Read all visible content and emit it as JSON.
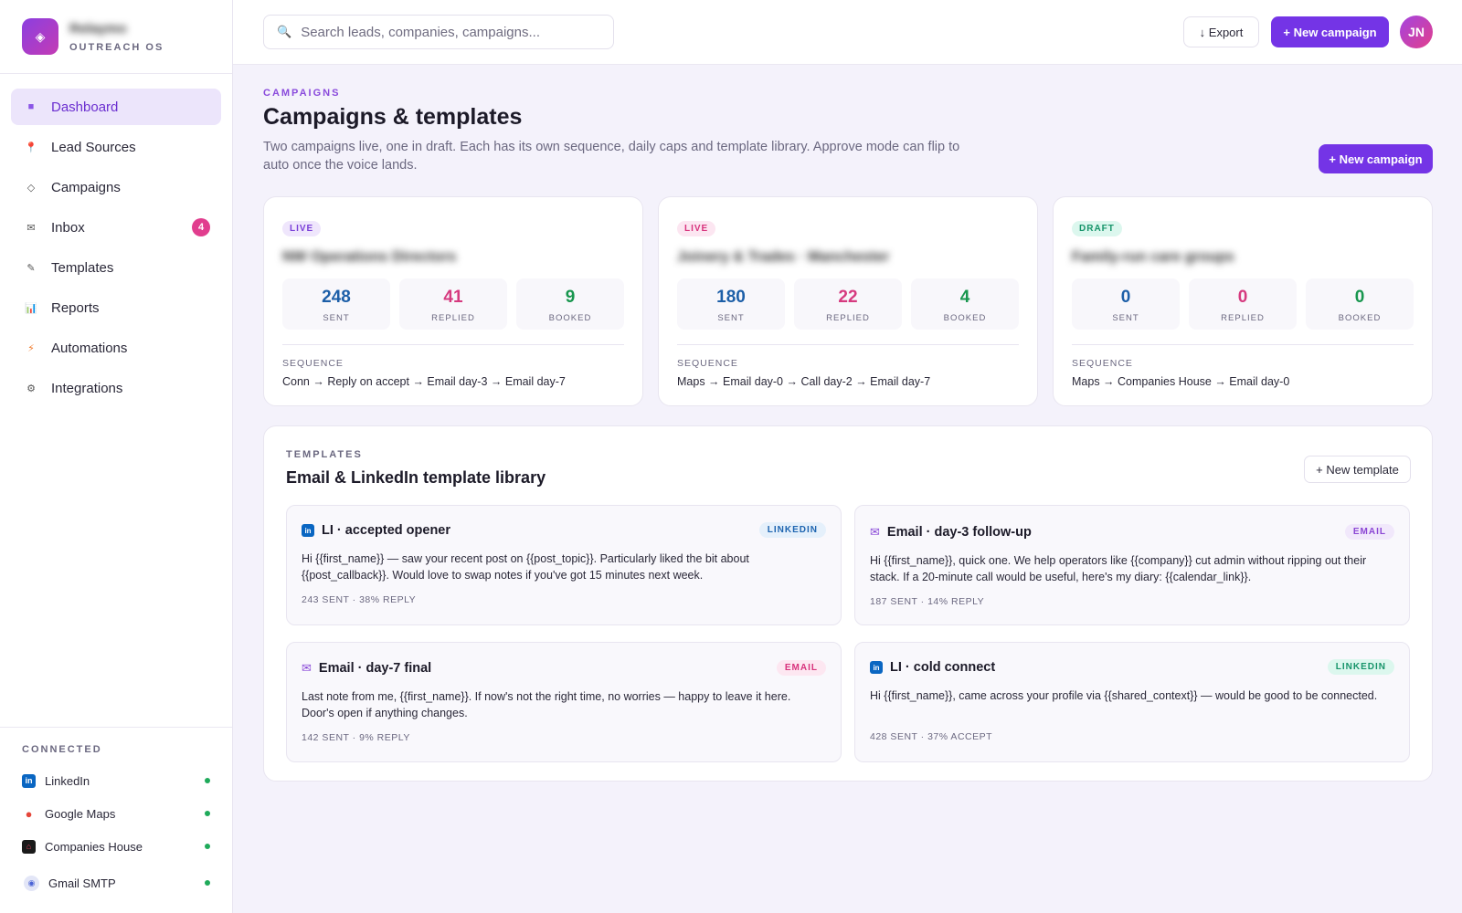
{
  "brand": {
    "name": "Relaymo",
    "subtitle": "OUTREACH OS",
    "logo_icon": "diamond-icon"
  },
  "sidebar": {
    "items": [
      {
        "label": "Dashboard",
        "icon": "grid-square-icon",
        "active": true
      },
      {
        "label": "Lead Sources",
        "icon": "pin-icon"
      },
      {
        "label": "Campaigns",
        "icon": "diamond-outline-icon"
      },
      {
        "label": "Inbox",
        "icon": "mail-icon",
        "badge": "4"
      },
      {
        "label": "Templates",
        "icon": "pen-icon"
      },
      {
        "label": "Reports",
        "icon": "bar-chart-icon"
      },
      {
        "label": "Automations",
        "icon": "bolt-icon"
      },
      {
        "label": "Integrations",
        "icon": "gear-icon"
      }
    ],
    "connected_title": "CONNECTED",
    "connected": [
      {
        "label": "LinkedIn",
        "icon": "linkedin-icon",
        "status": "connected"
      },
      {
        "label": "Google Maps",
        "icon": "map-pin-icon",
        "status": "connected"
      },
      {
        "label": "Companies House",
        "icon": "companies-house-icon",
        "status": "connected"
      },
      {
        "label": "Gmail SMTP",
        "icon": "gmail-icon",
        "status": "connected"
      }
    ]
  },
  "topbar": {
    "search_placeholder": "Search leads, companies, campaigns...",
    "export_label": "↓ Export",
    "new_campaign_label": "+ New campaign",
    "avatar_initials": "JN"
  },
  "page": {
    "eyebrow": "CAMPAIGNS",
    "title": "Campaigns & templates",
    "description": "Two campaigns live, one in draft. Each has its own sequence, daily caps and template library. Approve mode can flip to auto once the voice lands.",
    "new_campaign_label": "+ New campaign"
  },
  "campaigns": [
    {
      "status": "LIVE",
      "name": "NW Operations Directors",
      "stats": [
        {
          "value": "248",
          "label": "SENT"
        },
        {
          "value": "41",
          "label": "REPLIED"
        },
        {
          "value": "9",
          "label": "BOOKED"
        }
      ],
      "sequence_title": "SEQUENCE",
      "sequence": "Conn → Reply on accept → Email day-3 → Email day-7"
    },
    {
      "status": "LIVE",
      "name": "Joinery & Trades · Manchester",
      "stats": [
        {
          "value": "180",
          "label": "SENT"
        },
        {
          "value": "22",
          "label": "REPLIED"
        },
        {
          "value": "4",
          "label": "BOOKED"
        }
      ],
      "sequence_title": "SEQUENCE",
      "sequence": "Maps → Email day-0 → Call day-2 → Email day-7"
    },
    {
      "status": "DRAFT",
      "name": "Family-run care groups",
      "stats": [
        {
          "value": "0",
          "label": "SENT"
        },
        {
          "value": "0",
          "label": "REPLIED"
        },
        {
          "value": "0",
          "label": "BOOKED"
        }
      ],
      "sequence_title": "SEQUENCE",
      "sequence": "Maps → Companies House → Email day-0"
    }
  ],
  "library": {
    "eyebrow": "TEMPLATES",
    "title": "Email & LinkedIn template library",
    "new_template_label": "+ New template",
    "templates": [
      {
        "title": "LI · accepted opener",
        "tag": "LINKEDIN",
        "icon": "linkedin-icon",
        "body": "Hi {{first_name}} — saw your recent post on {{post_topic}}. Particularly liked the bit about {{post_callback}}. Would love to swap notes if you've got 15 minutes next week.",
        "meta": "243 SENT · 38% REPLY"
      },
      {
        "title": "Email · day-3 follow-up",
        "tag": "EMAIL",
        "icon": "mail-icon",
        "body": "Hi {{first_name}}, quick one. We help operators like {{company}} cut admin without ripping out their stack. If a 20-minute call would be useful, here's my diary: {{calendar_link}}.",
        "meta": "187 SENT · 14% REPLY"
      },
      {
        "title": "Email · day-7 final",
        "tag": "EMAIL",
        "icon": "mail-icon",
        "body": "Last note from me, {{first_name}}. If now's not the right time, no worries — happy to leave it here. Door's open if anything changes.",
        "meta": "142 SENT · 9% REPLY"
      },
      {
        "title": "LI · cold connect",
        "tag": "LINKEDIN",
        "icon": "linkedin-icon",
        "body": "Hi {{first_name}}, came across your profile via {{shared_context}} — would be good to be connected.",
        "meta": "428 SENT · 37% ACCEPT"
      }
    ]
  }
}
